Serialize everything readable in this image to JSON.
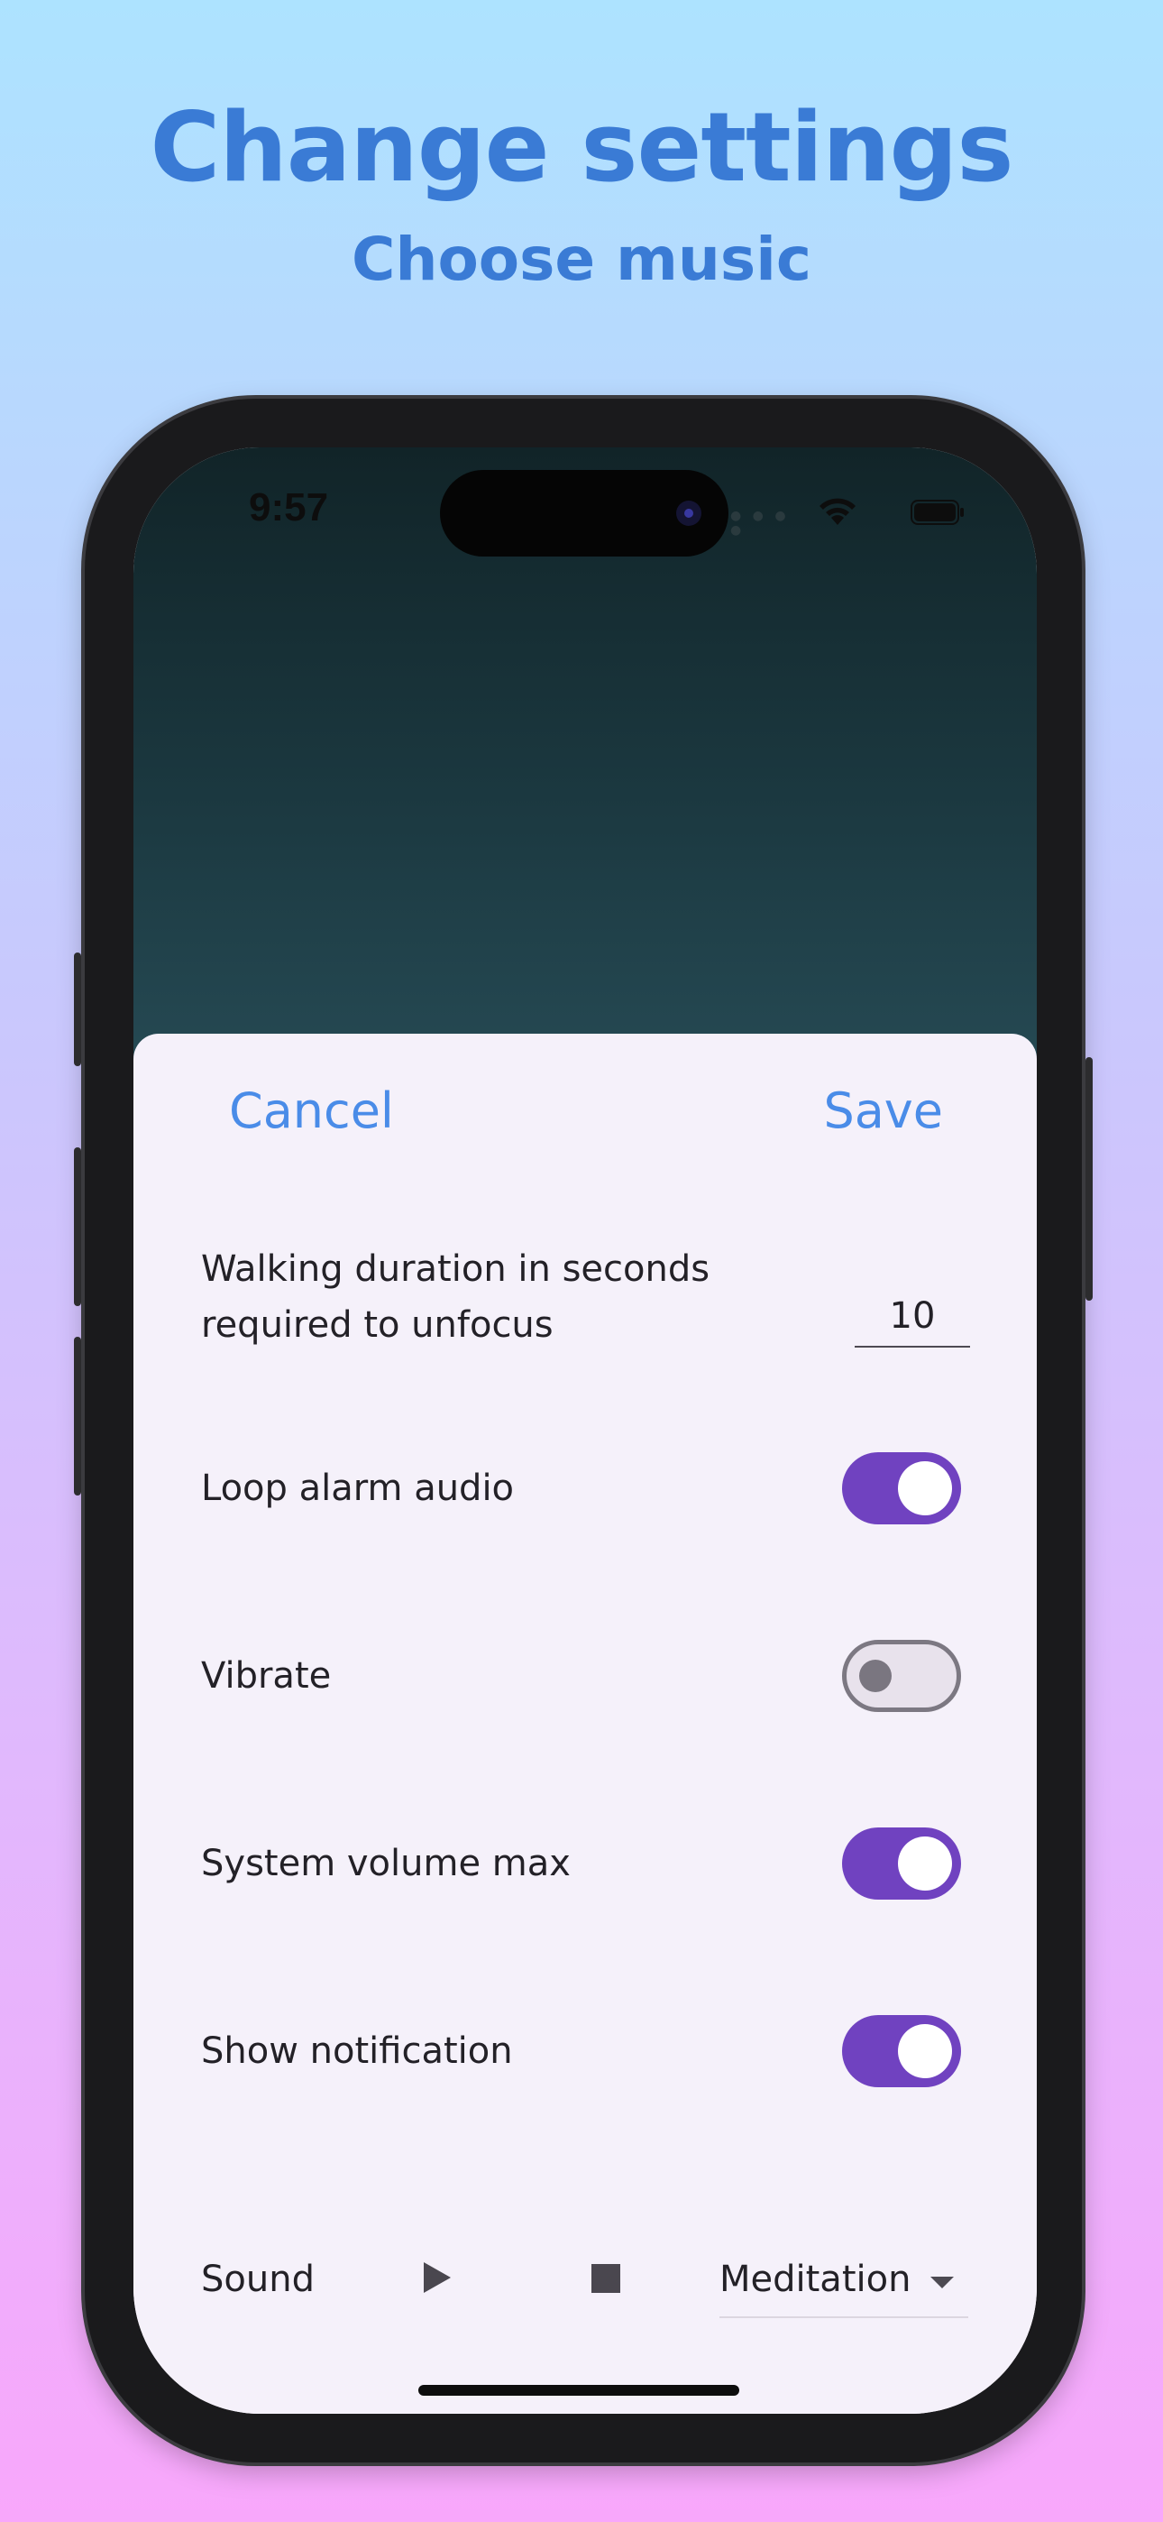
{
  "promo": {
    "title": "Change settings",
    "subtitle": "Choose music"
  },
  "status_bar": {
    "time": "9:57",
    "icons": [
      "wifi-icon",
      "battery-icon"
    ]
  },
  "sheet": {
    "cancel_label": "Cancel",
    "save_label": "Save",
    "walking_duration": {
      "label_line1": "Walking duration in seconds",
      "label_line2": "required to unfocus",
      "value": "10"
    },
    "toggles": [
      {
        "label": "Loop alarm audio",
        "on": true
      },
      {
        "label": "Vibrate",
        "on": false
      },
      {
        "label": "System volume max",
        "on": true
      },
      {
        "label": "Show notification",
        "on": true
      }
    ],
    "sound": {
      "label": "Sound",
      "selected": "Meditation",
      "play_icon": "play-icon",
      "stop_icon": "stop-icon"
    }
  },
  "colors": {
    "accent_purple": "#7042c0",
    "link_blue": "#4a8ce8",
    "headline_blue": "#3a7bd5"
  }
}
